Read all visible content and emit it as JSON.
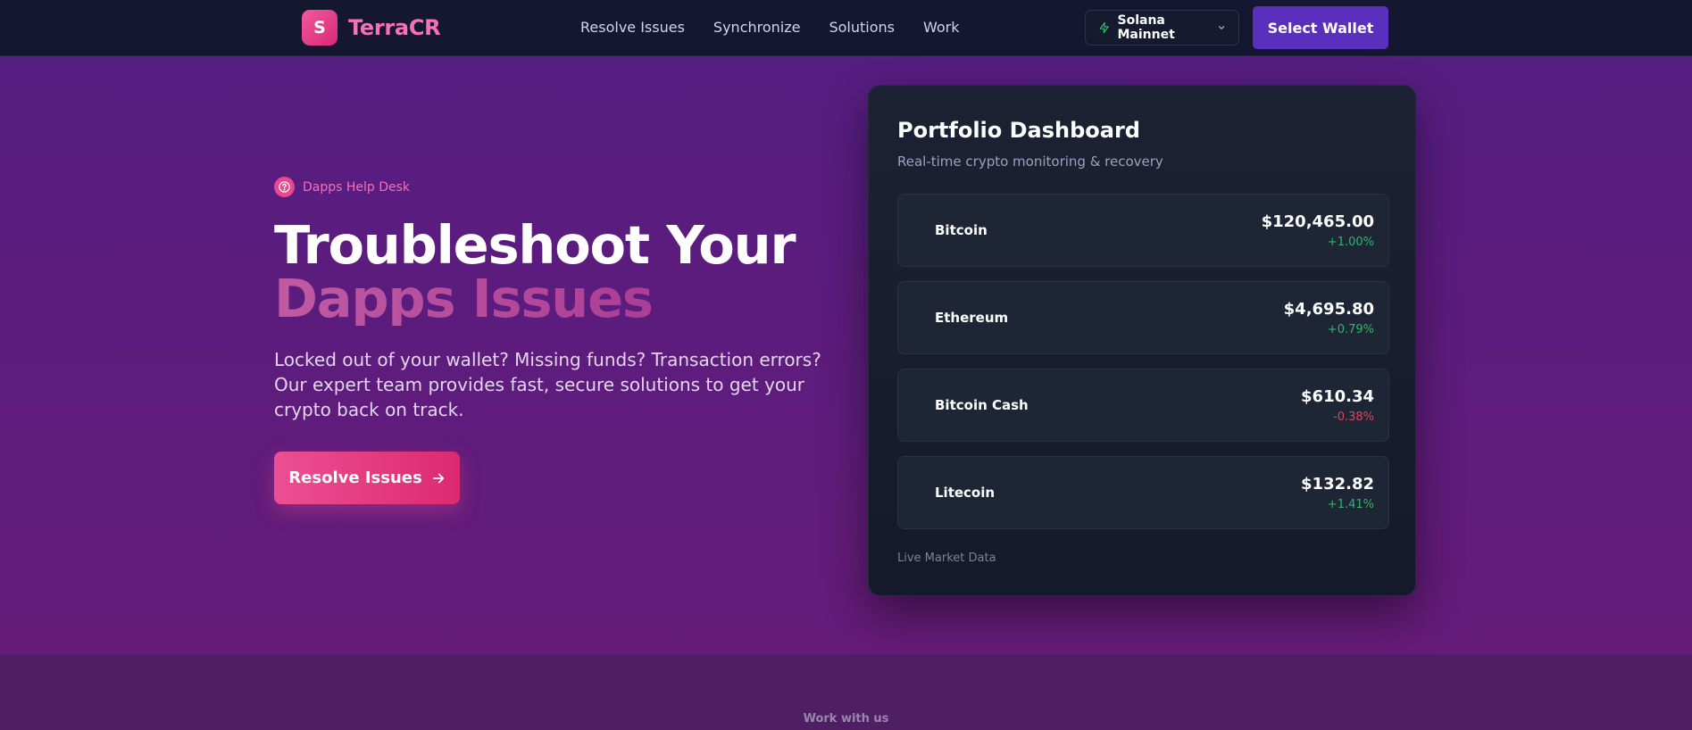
{
  "header": {
    "brand_initial": "S",
    "brand_name": "TerraCR",
    "nav": [
      "Resolve Issues",
      "Synchronize",
      "Solutions",
      "Work"
    ],
    "network_label": "Solana Mainnet",
    "wallet_label": "Select Wallet"
  },
  "hero": {
    "badge": "Dapps Help Desk",
    "title_line1": "Troubleshoot Your",
    "title_line2": "Dapps Issues",
    "description": "Locked out of your wallet? Missing funds? Transaction errors? Our expert team provides fast, secure solutions to get your crypto back on track.",
    "cta_label": "Resolve Issues"
  },
  "dashboard": {
    "title": "Portfolio Dashboard",
    "subtitle": "Real-time crypto monitoring & recovery",
    "assets": [
      {
        "name": "Bitcoin",
        "price": "$120,465.00",
        "change": "+1.00%",
        "direction": "up"
      },
      {
        "name": "Ethereum",
        "price": "$4,695.80",
        "change": "+0.79%",
        "direction": "up"
      },
      {
        "name": "Bitcoin Cash",
        "price": "$610.34",
        "change": "-0.38%",
        "direction": "down"
      },
      {
        "name": "Litecoin",
        "price": "$132.82",
        "change": "+1.41%",
        "direction": "up"
      }
    ],
    "footer": "Live Market Data"
  },
  "lower": {
    "label": "Work with us"
  },
  "colors": {
    "accent_pink": "#ec4899",
    "wallet_purple": "#5b2fbd",
    "positive": "#34b26a",
    "negative": "#d6485d"
  },
  "icons": {
    "network": "bolt-icon",
    "network_menu": "chevron-down-icon",
    "badge": "help-circle-icon",
    "cta": "arrow-right-icon"
  }
}
